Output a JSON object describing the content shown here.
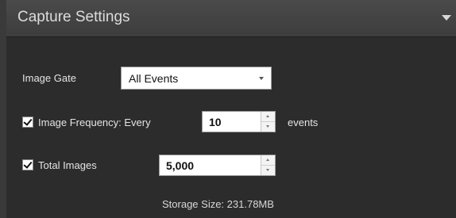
{
  "header": {
    "title": "Capture Settings",
    "collapse_icon": "triangle-down-icon"
  },
  "image_gate": {
    "label": "Image Gate",
    "selected": "All Events"
  },
  "image_frequency": {
    "checked": true,
    "label": "Image Frequency: Every",
    "value": "10",
    "suffix": "events"
  },
  "total_images": {
    "checked": true,
    "label": "Total Images",
    "value": "5,000"
  },
  "storage": {
    "text": "Storage Size: 231.78MB"
  },
  "colors": {
    "panel_bg": "#2c2c2c",
    "header_bg": "#444444",
    "text": "#e4e4e4"
  }
}
